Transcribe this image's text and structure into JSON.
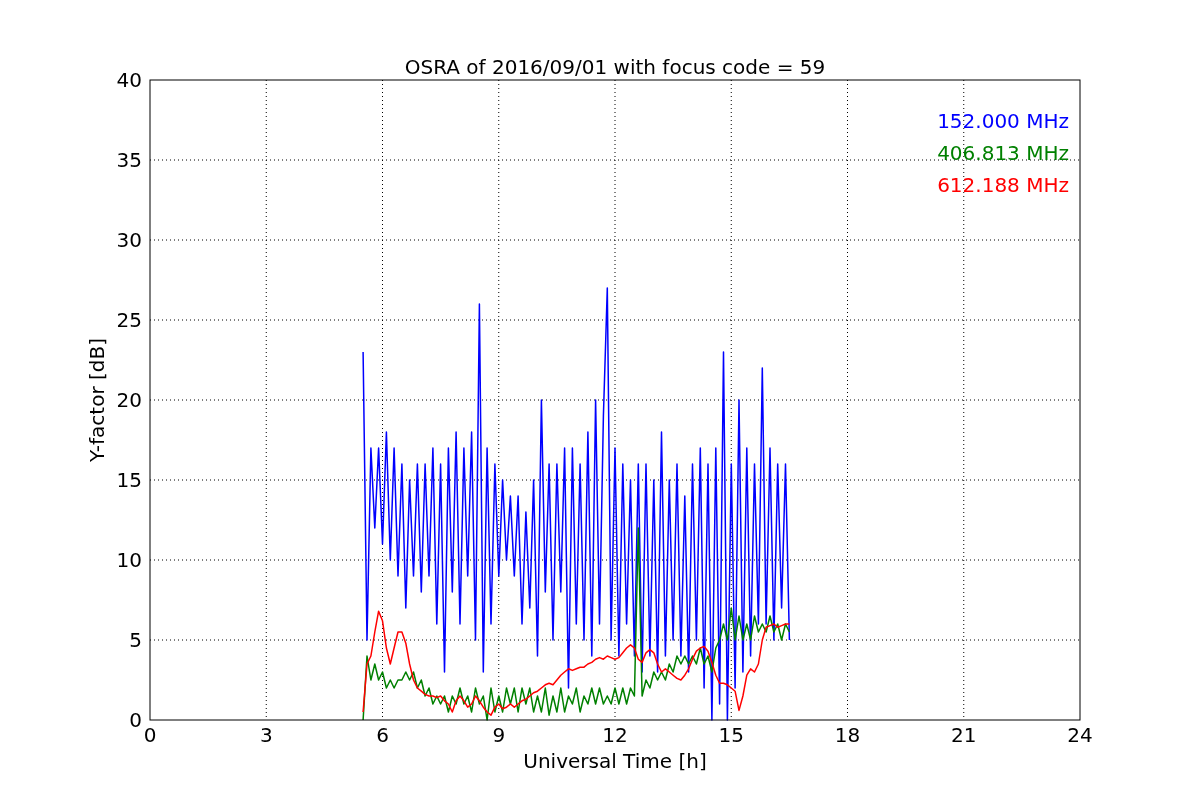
{
  "chart_data": {
    "type": "line",
    "title": "OSRA of 2016/09/01 with focus code = 59",
    "xlabel": "Universal Time [h]",
    "ylabel": "Y-factor [dB]",
    "x": [
      5.5,
      5.6,
      5.7,
      5.8,
      5.9,
      6.0,
      6.1,
      6.2,
      6.3,
      6.4,
      6.5,
      6.6,
      6.7,
      6.8,
      6.9,
      7.0,
      7.1,
      7.2,
      7.3,
      7.4,
      7.5,
      7.6,
      7.7,
      7.8,
      7.9,
      8.0,
      8.1,
      8.2,
      8.3,
      8.4,
      8.5,
      8.6,
      8.7,
      8.8,
      8.9,
      9.0,
      9.1,
      9.2,
      9.3,
      9.4,
      9.5,
      9.6,
      9.7,
      9.8,
      9.9,
      10.0,
      10.1,
      10.2,
      10.3,
      10.4,
      10.5,
      10.6,
      10.7,
      10.8,
      10.9,
      11.0,
      11.1,
      11.2,
      11.3,
      11.4,
      11.5,
      11.6,
      11.7,
      11.8,
      11.9,
      12.0,
      12.1,
      12.2,
      12.3,
      12.4,
      12.5,
      12.6,
      12.7,
      12.8,
      12.9,
      13.0,
      13.1,
      13.2,
      13.3,
      13.4,
      13.5,
      13.6,
      13.7,
      13.8,
      13.9,
      14.0,
      14.1,
      14.2,
      14.3,
      14.4,
      14.5,
      14.6,
      14.7,
      14.8,
      14.9,
      15.0,
      15.1,
      15.2,
      15.3,
      15.4,
      15.5,
      15.6,
      15.7,
      15.8,
      15.9,
      16.0,
      16.1,
      16.2,
      16.3,
      16.4,
      16.5
    ],
    "series": [
      {
        "name": "152.000 MHz",
        "color": "#0000ff",
        "values": [
          23,
          5,
          17,
          12,
          17,
          11,
          18,
          10,
          17,
          9,
          16,
          7,
          15,
          9,
          16,
          8,
          16,
          9,
          17,
          6,
          16,
          3,
          17,
          8,
          18,
          6,
          17,
          9,
          18,
          5,
          26,
          3,
          17,
          6,
          16,
          9,
          15,
          10,
          14,
          9,
          14,
          6,
          13,
          7,
          15,
          4,
          20,
          8,
          16,
          5,
          16,
          8,
          17,
          2,
          17,
          6,
          16,
          5,
          18,
          4,
          20,
          6,
          19,
          27,
          5,
          17,
          4,
          16,
          6,
          15,
          4,
          16,
          3,
          16,
          4,
          15,
          3,
          18,
          4,
          15,
          5,
          16,
          4,
          14,
          3,
          16,
          5,
          17,
          2,
          16,
          0,
          17,
          1,
          23,
          0,
          16,
          2,
          20,
          3,
          17,
          4,
          16,
          6,
          22,
          6,
          17,
          5,
          16,
          7,
          16,
          5
        ]
      },
      {
        "name": "406.813 MHz",
        "color": "#008000",
        "values": [
          0,
          4,
          2.5,
          3.5,
          2.5,
          3,
          2,
          2.5,
          2,
          2.5,
          2.5,
          3,
          2.5,
          3,
          2,
          2.5,
          1.5,
          2,
          1,
          1.5,
          1,
          1.5,
          0.5,
          1.5,
          1,
          2,
          1,
          1.5,
          0.5,
          2,
          1,
          1.5,
          0,
          2,
          0.5,
          1.5,
          0.5,
          2,
          1,
          2,
          0.5,
          2,
          1,
          2,
          0.5,
          1.5,
          0.5,
          2,
          0.3,
          1.5,
          0.5,
          2,
          0.5,
          1.5,
          1,
          2,
          0.5,
          1.5,
          1,
          2,
          1,
          2,
          1,
          1.5,
          1,
          2,
          1,
          2,
          1,
          2,
          1.5,
          12,
          1.5,
          2.5,
          2,
          3,
          2.5,
          3,
          2.5,
          3.5,
          3,
          4,
          3.5,
          4,
          3.5,
          4,
          3.5,
          4.5,
          3.5,
          4,
          3,
          4.5,
          5,
          6,
          5,
          7,
          5,
          6.5,
          5,
          6,
          5,
          6.5,
          5.5,
          6,
          5.5,
          6.5,
          5.5,
          6,
          5,
          6,
          5.5
        ]
      },
      {
        "name": "612.188 MHz",
        "color": "#ff0000",
        "values": [
          0.5,
          3.5,
          4,
          5.5,
          6.8,
          6.2,
          4.5,
          3.5,
          4.5,
          5.5,
          5.5,
          4.8,
          3.5,
          2.5,
          2,
          1.8,
          1.6,
          1.5,
          1.5,
          1.4,
          1.5,
          1.2,
          1,
          0.5,
          1.2,
          1.5,
          1.2,
          0.8,
          1,
          1.5,
          1.2,
          0.8,
          0.5,
          0.3,
          0.8,
          1,
          0.7,
          0.8,
          1,
          0.8,
          1,
          1.2,
          1.3,
          1.5,
          1.7,
          1.8,
          2,
          2.2,
          2.3,
          2.2,
          2.5,
          2.8,
          3,
          3.2,
          3.1,
          3.2,
          3.3,
          3.3,
          3.5,
          3.6,
          3.8,
          3.9,
          3.8,
          4,
          3.9,
          3.8,
          3.9,
          4.2,
          4.5,
          4.7,
          4.5,
          3.8,
          3.6,
          4.2,
          4.4,
          4.2,
          3.5,
          3,
          3.2,
          3,
          2.8,
          2.6,
          2.5,
          2.8,
          3.2,
          3.8,
          4.3,
          4.5,
          4.6,
          4.3,
          3.6,
          2.8,
          2.3,
          2.3,
          2.2,
          2,
          1.8,
          0.6,
          1.5,
          2.8,
          3.2,
          3,
          3.5,
          5,
          5.8,
          5.9,
          6,
          5.8,
          5.9,
          6,
          6
        ]
      }
    ],
    "grid": true,
    "xlim": [
      0,
      24
    ],
    "ylim": [
      0,
      40
    ],
    "xticks": [
      0,
      3,
      6,
      9,
      12,
      15,
      18,
      21,
      24
    ],
    "yticks": [
      0,
      5,
      10,
      15,
      20,
      25,
      30,
      35,
      40
    ]
  }
}
